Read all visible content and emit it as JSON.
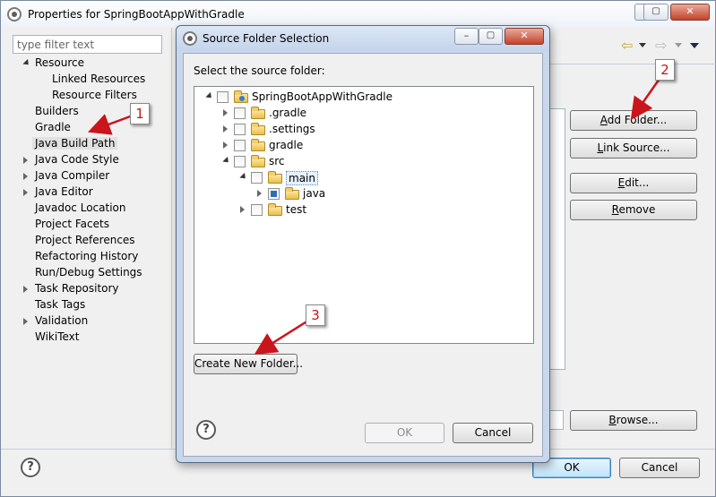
{
  "main_window": {
    "title": "Properties for SpringBootAppWithGradle",
    "controls": {
      "minimize": "–",
      "maximize": "▢",
      "close": "✕"
    }
  },
  "sidebar": {
    "filter_placeholder": "type filter text",
    "items": [
      {
        "label": "Resource",
        "expander": "expanded"
      },
      {
        "label": "Linked Resources",
        "expander": "none"
      },
      {
        "label": "Resource Filters",
        "expander": "none"
      },
      {
        "label": "Builders",
        "expander": "none"
      },
      {
        "label": "Gradle",
        "expander": "none"
      },
      {
        "label": "Java Build Path",
        "expander": "none",
        "selected": true
      },
      {
        "label": "Java Code Style",
        "expander": "collapsed"
      },
      {
        "label": "Java Compiler",
        "expander": "collapsed"
      },
      {
        "label": "Java Editor",
        "expander": "collapsed"
      },
      {
        "label": "Javadoc Location",
        "expander": "none"
      },
      {
        "label": "Project Facets",
        "expander": "none"
      },
      {
        "label": "Project References",
        "expander": "none"
      },
      {
        "label": "Refactoring History",
        "expander": "none"
      },
      {
        "label": "Run/Debug Settings",
        "expander": "none"
      },
      {
        "label": "Task Repository",
        "expander": "collapsed"
      },
      {
        "label": "Task Tags",
        "expander": "none"
      },
      {
        "label": "Validation",
        "expander": "collapsed"
      },
      {
        "label": "WikiText",
        "expander": "none"
      }
    ]
  },
  "right_panel": {
    "add_folder_prefix": "A",
    "add_folder_rest": "dd Folder...",
    "link_source_prefix": "L",
    "link_source_rest": "ink Source...",
    "edit_prefix": "E",
    "edit_rest": "dit...",
    "remove_prefix": "R",
    "remove_rest": "emove",
    "browse_prefix": "B",
    "browse_rest": "rowse..."
  },
  "bottom_buttons": {
    "ok": "OK",
    "cancel": "Cancel"
  },
  "dialog": {
    "title": "Source Folder Selection",
    "controls": {
      "minimize": "–",
      "maximize": "▢",
      "close": "✕"
    },
    "prompt": "Select the source folder:",
    "tree": [
      {
        "label": "SpringBootAppWithGradle",
        "depth": 0,
        "expander": "expanded",
        "checked": false,
        "icon": "project-icon"
      },
      {
        "label": ".gradle",
        "depth": 1,
        "expander": "collapsed",
        "checked": false,
        "icon": "folder-icon"
      },
      {
        "label": ".settings",
        "depth": 1,
        "expander": "collapsed",
        "checked": false,
        "icon": "folder-icon"
      },
      {
        "label": "gradle",
        "depth": 1,
        "expander": "collapsed",
        "checked": false,
        "icon": "folder-icon"
      },
      {
        "label": "src",
        "depth": 1,
        "expander": "expanded",
        "checked": false,
        "icon": "folder-icon"
      },
      {
        "label": "main",
        "depth": 2,
        "expander": "expanded",
        "checked": false,
        "icon": "folder-icon",
        "focused": true
      },
      {
        "label": "java",
        "depth": 3,
        "expander": "collapsed",
        "checked": true,
        "icon": "folder-icon"
      },
      {
        "label": "test",
        "depth": 2,
        "expander": "collapsed",
        "checked": false,
        "icon": "folder-icon"
      }
    ],
    "create_new_folder": "Create New Folder...",
    "ok": "OK",
    "cancel": "Cancel"
  },
  "annotations": {
    "one": "1",
    "two": "2",
    "three": "3",
    "arrow_color": "#c9151b"
  }
}
